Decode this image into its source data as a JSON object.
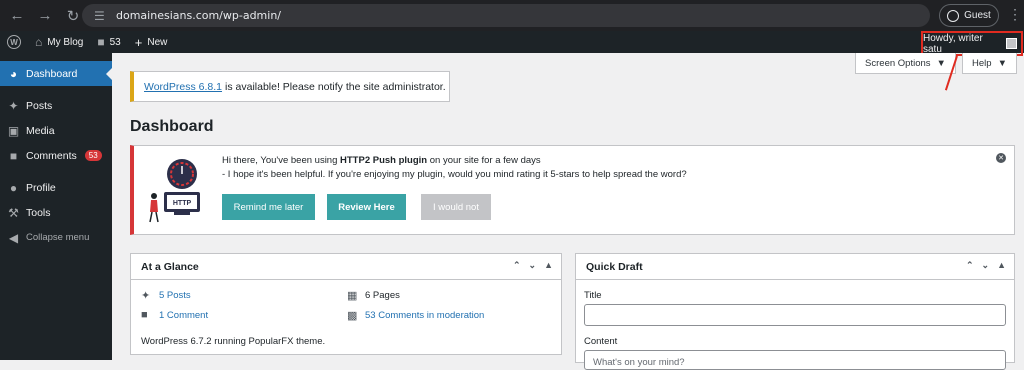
{
  "browser": {
    "url": "domainesians.com/wp-admin/",
    "profile_label": "Guest"
  },
  "adminbar": {
    "site_name": "My Blog",
    "comments_count": "53",
    "new_label": "New",
    "howdy": "Howdy, writer satu"
  },
  "sidebar": {
    "items": [
      {
        "label": "Dashboard",
        "icon": "gauge-icon"
      },
      {
        "label": "Posts",
        "icon": "pin-icon"
      },
      {
        "label": "Media",
        "icon": "media-icon"
      },
      {
        "label": "Comments",
        "icon": "comment-icon",
        "badge": "53"
      },
      {
        "label": "Profile",
        "icon": "user-icon"
      },
      {
        "label": "Tools",
        "icon": "wrench-icon"
      },
      {
        "label": "Collapse menu",
        "icon": "collapse-icon"
      }
    ]
  },
  "screen_meta": {
    "screen_options": "Screen Options",
    "help": "Help"
  },
  "update_nag": {
    "link": "WordPress 6.8.1",
    "text": "is available! Please notify the site administrator."
  },
  "page_title": "Dashboard",
  "plugin_notice": {
    "line1_pre": "Hi there, You've been using ",
    "line1_bold": "HTTP2 Push plugin",
    "line1_post": " on your site for a few days",
    "line2": "- I hope it's been helpful. If you're enjoying my plugin, would you mind rating it 5-stars to help spread the word?",
    "illus_label": "HTTP",
    "btn_remind": "Remind me later",
    "btn_review": "Review Here",
    "btn_never": "I would not"
  },
  "at_a_glance": {
    "title": "At a Glance",
    "posts": "5 Posts",
    "pages": "6 Pages",
    "comments": "1 Comment",
    "moderation": "53 Comments in moderation",
    "footer": "WordPress 6.7.2 running PopularFX theme."
  },
  "quick_draft": {
    "title": "Quick Draft",
    "title_label": "Title",
    "content_label": "Content",
    "content_placeholder": "What's on your mind?"
  },
  "colors": {
    "accent": "#2271b1",
    "admin_bar": "#1d2327",
    "highlight": "#e02b20",
    "teal_button": "#3aa3a5"
  }
}
